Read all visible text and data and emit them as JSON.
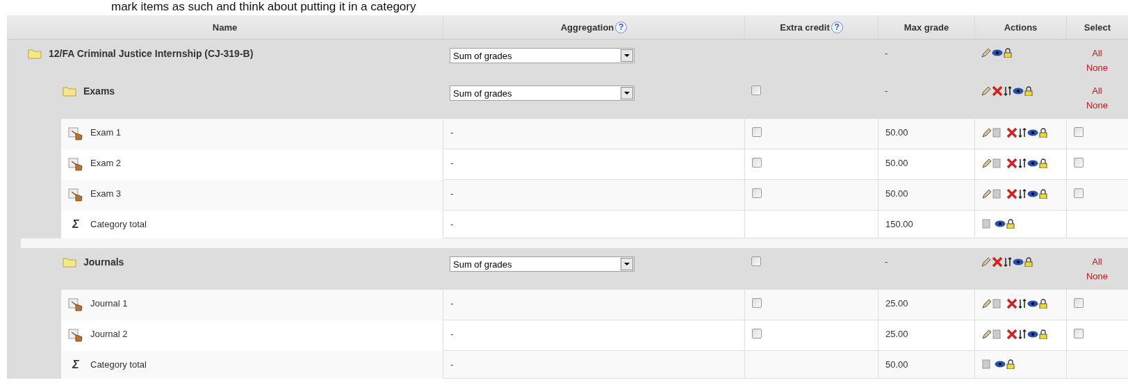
{
  "note": "mark items as such and think about putting it in a category",
  "columns": [
    {
      "label": "Name"
    },
    {
      "label": "Aggregation",
      "help": "?"
    },
    {
      "label": "Extra credit",
      "help": "?"
    },
    {
      "label": "Max grade"
    },
    {
      "label": "Actions"
    },
    {
      "label": "Select"
    }
  ],
  "tree": {
    "kind": "course",
    "name": "12/FA Criminal Justice Internship (CJ-319-B)",
    "aggregation": "Sum of grades",
    "max_grade": "-",
    "select_links": [
      "All",
      "None"
    ],
    "children": [
      {
        "kind": "category",
        "name": "Exams",
        "aggregation": "Sum of grades",
        "extra_credit": false,
        "max_grade": "-",
        "select_links": [
          "All",
          "None"
        ],
        "children": [
          {
            "kind": "item",
            "name": "Exam 1",
            "aggregation": "-",
            "extra_credit": false,
            "max_grade": "50.00",
            "selected": false
          },
          {
            "kind": "item",
            "name": "Exam 2",
            "aggregation": "-",
            "extra_credit": false,
            "max_grade": "50.00",
            "selected": false
          },
          {
            "kind": "item",
            "name": "Exam 3",
            "aggregation": "-",
            "extra_credit": false,
            "max_grade": "50.00",
            "selected": false
          },
          {
            "kind": "total",
            "symbol": "Σ",
            "name": "Category total",
            "aggregation": "-",
            "max_grade": "150.00"
          }
        ]
      },
      {
        "kind": "category",
        "name": "Journals",
        "aggregation": "Sum of grades",
        "extra_credit": false,
        "max_grade": "-",
        "select_links": [
          "All",
          "None"
        ],
        "children": [
          {
            "kind": "item",
            "name": "Journal 1",
            "aggregation": "-",
            "extra_credit": false,
            "max_grade": "25.00",
            "selected": false
          },
          {
            "kind": "item",
            "name": "Journal 2",
            "aggregation": "-",
            "extra_credit": false,
            "max_grade": "25.00",
            "selected": false
          },
          {
            "kind": "total",
            "symbol": "Σ",
            "name": "Category total",
            "aggregation": "-",
            "max_grade": "50.00"
          }
        ]
      }
    ]
  }
}
